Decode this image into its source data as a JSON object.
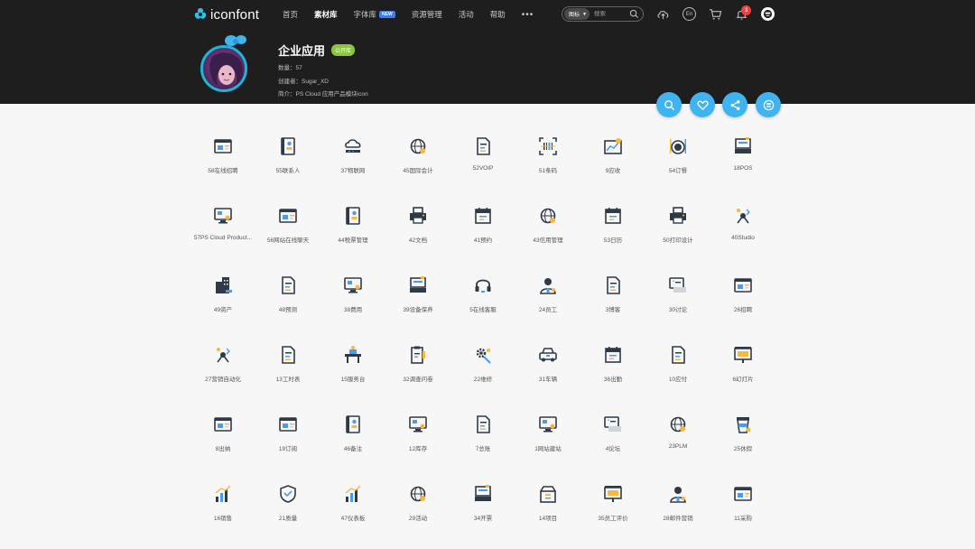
{
  "brand": {
    "name": "iconfont"
  },
  "nav": {
    "items": [
      {
        "label": "首页",
        "active": false
      },
      {
        "label": "素材库",
        "active": true
      },
      {
        "label": "字体库",
        "active": false,
        "badge": "NEW"
      },
      {
        "label": "资源管理",
        "active": false
      },
      {
        "label": "活动",
        "active": false
      },
      {
        "label": "帮助",
        "active": false
      }
    ],
    "more": "•••"
  },
  "search": {
    "type_label": "图标",
    "placeholder": "搜索"
  },
  "toolbar": {
    "upload_icon": "cloud-upload-icon",
    "lang_label": "En",
    "cart_icon": "cart-icon",
    "bell_icon": "bell-icon",
    "notification_count": "3"
  },
  "collection": {
    "title": "企业应用",
    "badge": "公开库",
    "count_label": "数量：",
    "count": "57",
    "creator_label": "创建者：",
    "creator": "Sugar_XD",
    "intro_label": "简介：",
    "intro": "PS Cloud 应用产品模块icon"
  },
  "actions": [
    {
      "name": "search",
      "icon": "search-icon"
    },
    {
      "name": "favorite",
      "icon": "heart-icon"
    },
    {
      "name": "share",
      "icon": "share-icon"
    },
    {
      "name": "manage",
      "icon": "stack-icon"
    }
  ],
  "colors": {
    "accent": "#3fb4f0",
    "dark_bg": "#1e1e1e",
    "badge_green": "#8cc63f",
    "notif_red": "#f04040",
    "icon_dark": "#2f3a48",
    "icon_yellow": "#f5b840",
    "icon_blue": "#4a9bf0"
  },
  "icons": [
    {
      "label": "58在线招聘",
      "glyph": "window"
    },
    {
      "label": "55联系人",
      "glyph": "book"
    },
    {
      "label": "37物联网",
      "glyph": "cloud"
    },
    {
      "label": "45国际会计",
      "glyph": "globe"
    },
    {
      "label": "52VOIP",
      "glyph": "doc"
    },
    {
      "label": "51条码",
      "glyph": "scan"
    },
    {
      "label": "9应收",
      "glyph": "chart"
    },
    {
      "label": "54订餐",
      "glyph": "dish"
    },
    {
      "label": "18POS",
      "glyph": "pos"
    },
    {
      "label": "57PS Cloud Product...",
      "glyph": "monitor"
    },
    {
      "label": "56网站在线聊天",
      "glyph": "window"
    },
    {
      "label": "44税票管理",
      "glyph": "book"
    },
    {
      "label": "42文档",
      "glyph": "printer"
    },
    {
      "label": "41预约",
      "glyph": "calendar"
    },
    {
      "label": "43信用管理",
      "glyph": "globe"
    },
    {
      "label": "53日历",
      "glyph": "calendar"
    },
    {
      "label": "50打印设计",
      "glyph": "printer"
    },
    {
      "label": "40Studio",
      "glyph": "compass"
    },
    {
      "label": "49资产",
      "glyph": "building"
    },
    {
      "label": "48预测",
      "glyph": "doc"
    },
    {
      "label": "38费用",
      "glyph": "monitor"
    },
    {
      "label": "39设备保养",
      "glyph": "pos"
    },
    {
      "label": "5在线客服",
      "glyph": "headset"
    },
    {
      "label": "24员工",
      "glyph": "person"
    },
    {
      "label": "3博客",
      "glyph": "doc"
    },
    {
      "label": "30讨论",
      "glyph": "chat"
    },
    {
      "label": "26招聘",
      "glyph": "window"
    },
    {
      "label": "27营销自动化",
      "glyph": "compass"
    },
    {
      "label": "13工时表",
      "glyph": "doc"
    },
    {
      "label": "15服务台",
      "glyph": "desk"
    },
    {
      "label": "32调查问卷",
      "glyph": "clipboard"
    },
    {
      "label": "22维修",
      "glyph": "gear"
    },
    {
      "label": "31车辆",
      "glyph": "car"
    },
    {
      "label": "36出勤",
      "glyph": "calendar"
    },
    {
      "label": "10应付",
      "glyph": "doc"
    },
    {
      "label": "6幻灯片",
      "glyph": "slides"
    },
    {
      "label": "8出纳",
      "glyph": "window"
    },
    {
      "label": "19订阅",
      "glyph": "window"
    },
    {
      "label": "46备注",
      "glyph": "book"
    },
    {
      "label": "12库存",
      "glyph": "monitor"
    },
    {
      "label": "7总账",
      "glyph": "doc"
    },
    {
      "label": "1网站建站",
      "glyph": "monitor"
    },
    {
      "label": "4论坛",
      "glyph": "chat"
    },
    {
      "label": "23PLM",
      "glyph": "globe"
    },
    {
      "label": "25休假",
      "glyph": "cup"
    },
    {
      "label": "16销售",
      "glyph": "bars"
    },
    {
      "label": "21质量",
      "glyph": "shield"
    },
    {
      "label": "47仪表板",
      "glyph": "bars"
    },
    {
      "label": "29活动",
      "glyph": "globe"
    },
    {
      "label": "34开票",
      "glyph": "pos"
    },
    {
      "label": "14项目",
      "glyph": "box"
    },
    {
      "label": "35员工评价",
      "glyph": "slides"
    },
    {
      "label": "28邮件营销",
      "glyph": "person"
    },
    {
      "label": "11采购",
      "glyph": "window"
    }
  ]
}
